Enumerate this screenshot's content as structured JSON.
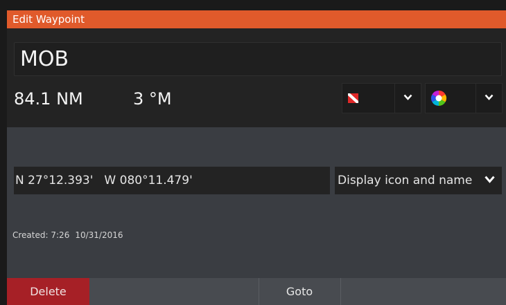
{
  "window": {
    "title": "Edit Waypoint"
  },
  "waypoint": {
    "name": "MOB",
    "distance": "84.1 NM",
    "bearing": "3 °M",
    "icon": "diver-down-flag-icon",
    "color_icon": "color-wheel-icon",
    "latitude": "N 27°12.393'",
    "longitude": "W 080°11.479'",
    "display_mode": "Display icon and name",
    "created_label": "Created:",
    "created_time": "7:26",
    "created_date": "10/31/2016"
  },
  "buttons": {
    "delete": "Delete",
    "goto": "Goto"
  },
  "colors": {
    "title_bar": "#e05a2b",
    "delete_button": "#a62026",
    "panel_dark": "#232323",
    "panel_light": "#3a3d42"
  }
}
